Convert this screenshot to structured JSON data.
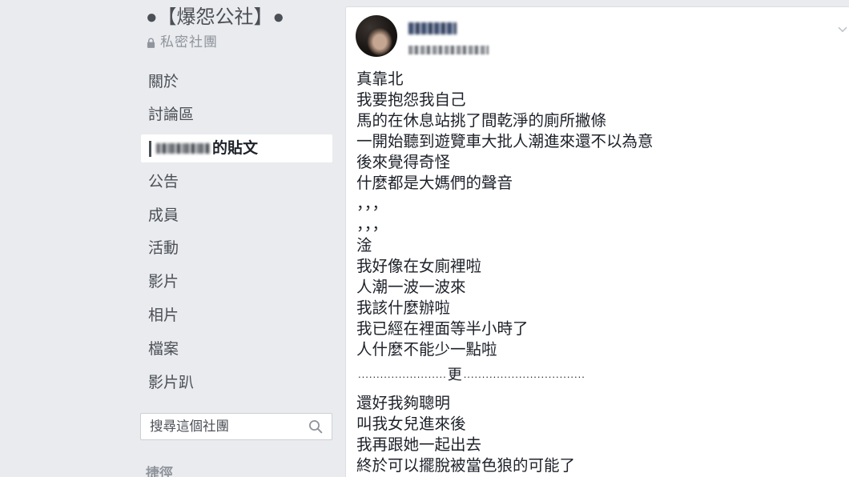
{
  "group": {
    "title": "●【爆怨公社】●",
    "privacy_label": "私密社團"
  },
  "sidebar": {
    "items": [
      {
        "label": "關於"
      },
      {
        "label": "討論區"
      },
      {
        "label": "的貼文",
        "selected": true
      },
      {
        "label": "公告"
      },
      {
        "label": "成員"
      },
      {
        "label": "活動"
      },
      {
        "label": "影片"
      },
      {
        "label": "相片"
      },
      {
        "label": "檔案"
      },
      {
        "label": "影片趴"
      }
    ],
    "search_placeholder": "搜尋這個社團",
    "shortcuts_heading": "捷徑"
  },
  "post": {
    "lines": [
      "真靠北",
      "我要抱怨我自己",
      "馬的在休息站挑了間乾淨的廁所撇條",
      "一開始聽到遊覽車大批人潮進來還不以為意",
      "後來覺得奇怪",
      "什麼都是大媽們的聲音",
      "，，，",
      "，，，",
      "淦",
      "我好像在女廁裡啦",
      "人潮一波一波來",
      "我該什麼辦啦",
      "我已經在裡面等半小時了",
      "人什麼不能少一點啦"
    ],
    "separator": {
      "left": "........................",
      "label": "更",
      "right": "................................."
    },
    "more_lines": [
      "還好我夠聰明",
      "叫我女兒進來後",
      "我再跟她一起出去",
      "終於可以擺脫被當色狼的可能了"
    ]
  },
  "icons": {
    "privacy": "lock-icon",
    "search": "search-icon",
    "post_menu": "chevron-down-icon"
  },
  "colors": {
    "page_background": "#e9ebee",
    "card_background": "#ffffff",
    "post_text": "#1d2129",
    "sidebar_text": "#4b4f56",
    "muted_text": "#90949c",
    "selected_bar": "#4b4f56"
  }
}
